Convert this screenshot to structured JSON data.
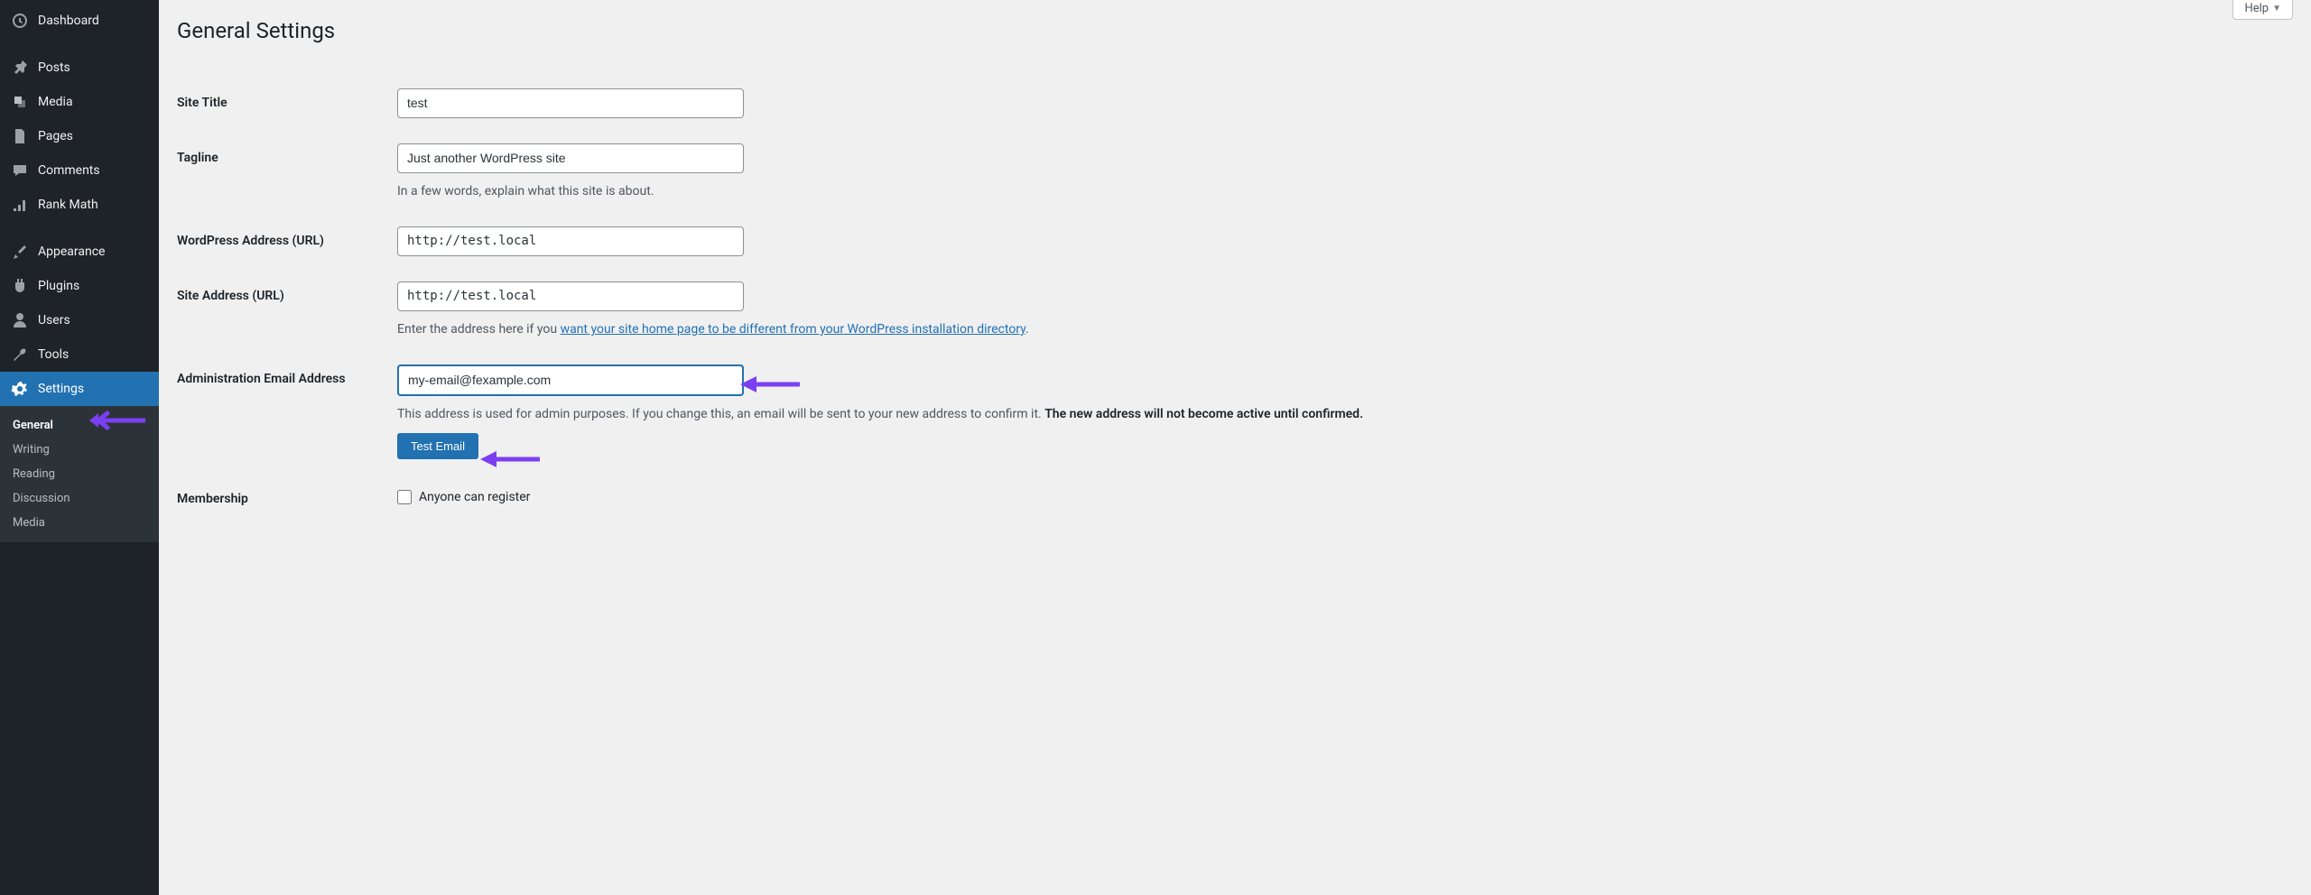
{
  "sidebar": {
    "items": [
      {
        "label": "Dashboard",
        "icon": "dashboard"
      },
      {
        "label": "Posts",
        "icon": "posts"
      },
      {
        "label": "Media",
        "icon": "media"
      },
      {
        "label": "Pages",
        "icon": "pages"
      },
      {
        "label": "Comments",
        "icon": "comments"
      },
      {
        "label": "Rank Math",
        "icon": "rankmath"
      },
      {
        "label": "Appearance",
        "icon": "appearance"
      },
      {
        "label": "Plugins",
        "icon": "plugins"
      },
      {
        "label": "Users",
        "icon": "users"
      },
      {
        "label": "Tools",
        "icon": "tools"
      },
      {
        "label": "Settings",
        "icon": "settings"
      }
    ],
    "submenu": [
      "General",
      "Writing",
      "Reading",
      "Discussion",
      "Media"
    ]
  },
  "header": {
    "title": "General Settings",
    "help": "Help"
  },
  "form": {
    "site_title_label": "Site Title",
    "site_title_value": "test",
    "tagline_label": "Tagline",
    "tagline_value": "Just another WordPress site",
    "tagline_desc": "In a few words, explain what this site is about.",
    "wp_address_label": "WordPress Address (URL)",
    "wp_address_value": "http://test.local",
    "site_address_label": "Site Address (URL)",
    "site_address_value": "http://test.local",
    "site_address_desc_pre": "Enter the address here if you ",
    "site_address_link": "want your site home page to be different from your WordPress installation directory",
    "site_address_desc_post": ".",
    "admin_email_label": "Administration Email Address",
    "admin_email_value": "my-email@fexample.com",
    "admin_email_desc_pre": "This address is used for admin purposes. If you change this, an email will be sent to your new address to confirm it. ",
    "admin_email_desc_strong": "The new address will not become active until confirmed.",
    "test_email_btn": "Test Email",
    "membership_label": "Membership",
    "membership_checkbox": "Anyone can register"
  }
}
